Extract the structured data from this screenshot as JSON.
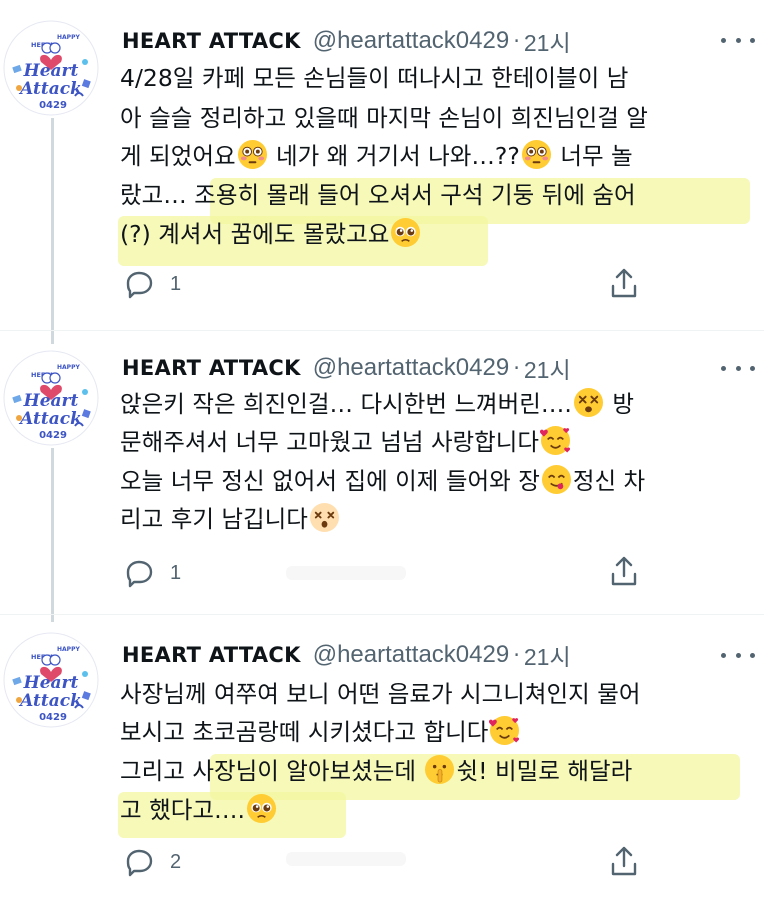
{
  "tweets": [
    {
      "author_name": "HEART ATTACK",
      "handle": "@heartattack0429",
      "separator": "·",
      "time": "21시",
      "lines": [
        "4/28일 카페 모든 손님들이 떠나시고 한테이블이 남",
        "아 슬슬 정리하고 있을때 마지막 손님이 희진님인걸 알",
        [
          "게 되었어요",
          "{flushed}",
          " 네가 왜 거기서 나와…??",
          "{flushed}",
          " 너무 놀"
        ],
        "랐고… 조용히 몰래 들어 오셔서 구석 기둥 뒤에 숨어",
        [
          "(?) 계셔서 꿈에도 몰랐고요",
          "{pleading}"
        ]
      ],
      "reply_count": "1"
    },
    {
      "author_name": "HEART ATTACK",
      "handle": "@heartattack0429",
      "separator": "·",
      "time": "21시",
      "lines": [
        [
          "앉은키 작은 희진인걸… 다시한번 느껴버린….",
          "{dizzy}",
          " 방"
        ],
        [
          "문해주셔서 너무 고마웠고 넘넘 사랑합니다",
          "{hearts}"
        ],
        [
          "오늘 너무 정신 없어서 집에 이제 들어와 장",
          "{yum}",
          "정신 차"
        ],
        [
          "리고 후기 남깁니다",
          "{dizzy_face}"
        ]
      ],
      "reply_count": "1"
    },
    {
      "author_name": "HEART ATTACK",
      "handle": "@heartattack0429",
      "separator": "·",
      "time": "21시",
      "lines": [
        "사장님께 여쭈여 보니 어떤 음료가 시그니쳐인지 물어",
        [
          "보시고 초코곰랑떼 시키셨다고 합니다",
          "{hearts}"
        ],
        [
          "그리고 사장님이 알아보셨는데 ",
          "{shush}",
          "쉿! 비밀로 해달라"
        ],
        [
          "고 했다고….",
          "{pleading}"
        ]
      ],
      "reply_count": "2"
    }
  ],
  "avatar": {
    "top_text": "HAPPY",
    "sub_text": "HEEJIN",
    "line1": "Heart",
    "line2": "Attack",
    "number": "0429"
  },
  "icons": {
    "reply": "reply-icon",
    "share": "share-icon",
    "more": "more-icon"
  },
  "colors": {
    "text": "#0f1419",
    "secondary": "#536471",
    "highlight": "#f3f7a0",
    "avatar_blue": "#3d55c4"
  }
}
